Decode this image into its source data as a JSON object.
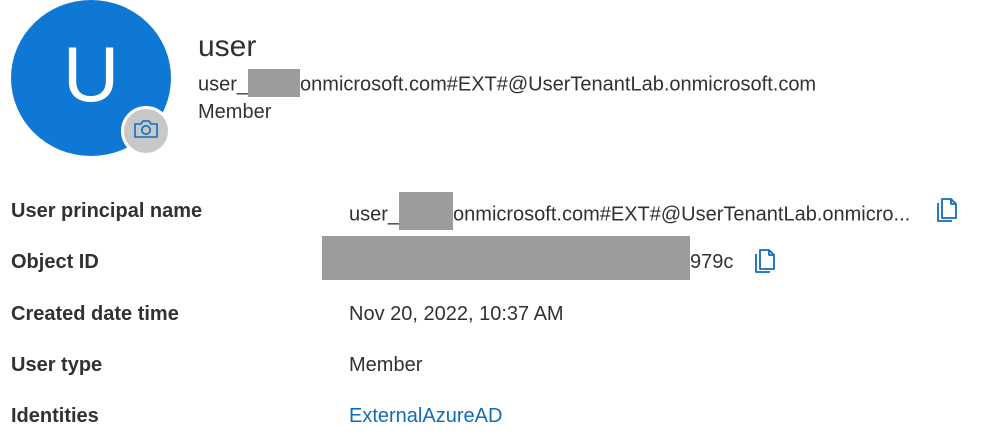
{
  "profile": {
    "initial": "U",
    "name": "user",
    "upn_prefix": "user_",
    "upn_suffix": "onmicrosoft.com#EXT#@UserTenantLab.onmicrosoft.com",
    "user_type": "Member"
  },
  "properties": {
    "upn_label": "User principal name",
    "upn_prefix": "user_",
    "upn_suffix": "onmicrosoft.com#EXT#@UserTenantLab.onmicro...",
    "object_id_label": "Object ID",
    "object_id_tail": "979c",
    "created_label": "Created date time",
    "created_value": "Nov 20, 2022, 10:37 AM",
    "user_type_label": "User type",
    "user_type_value": "Member",
    "identities_label": "Identities",
    "identities_value": "ExternalAzureAD"
  },
  "icons": {
    "camera": "camera-icon",
    "copy": "copy-icon"
  },
  "colors": {
    "avatar": "#0f78d4",
    "link": "#0f6cbd",
    "redaction": "#9c9c9c"
  }
}
